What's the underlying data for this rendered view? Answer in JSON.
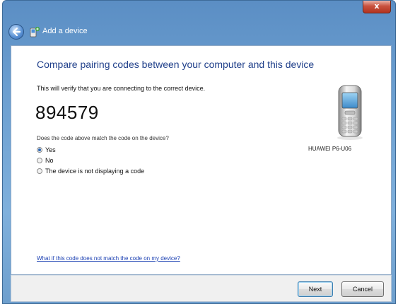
{
  "window": {
    "title": "Add a device",
    "close_label": "x"
  },
  "main": {
    "heading": "Compare pairing codes between your computer and this device",
    "verify_text": "This will verify that you are connecting to the correct device.",
    "pairing_code": "894579",
    "question": "Does the code above match the code on the device?",
    "options": [
      {
        "label": "Yes",
        "checked": true
      },
      {
        "label": "No",
        "checked": false
      },
      {
        "label": "The device is not displaying a code",
        "checked": false
      }
    ],
    "device_name": "HUAWEI P6-U06",
    "device_icon": "mobile-phone-icon",
    "help_link": "What if this code does not match the code on my device?"
  },
  "footer": {
    "next_label": "Next",
    "cancel_label": "Cancel"
  },
  "colors": {
    "title_bar": "#6c9fd0",
    "heading": "#1f3f8a",
    "link": "#1a3fb2",
    "close_button": "#c8523e"
  }
}
